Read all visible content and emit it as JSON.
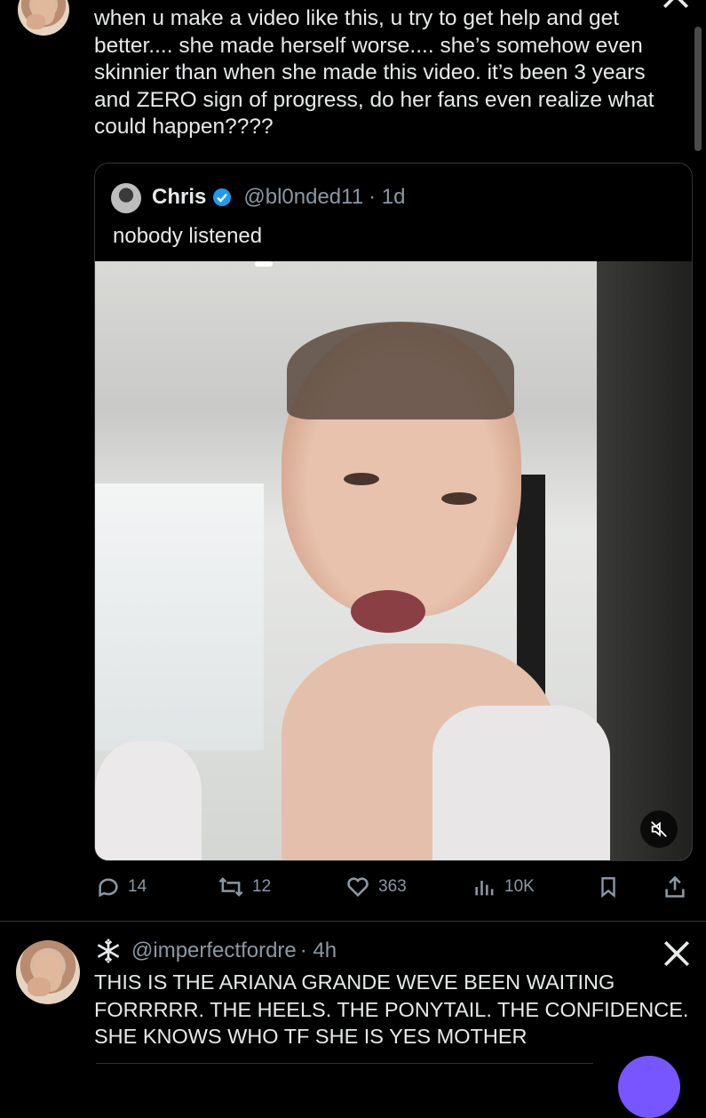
{
  "top_tweet": {
    "text": "when u make a video like this, u try to get help and get better.... she made herself worse.... she’s somehow even skinnier than when she made this video. it’s been 3 years and ZERO sign of progress, do her fans even realize what could happen????",
    "quoted": {
      "display_name": "Chris",
      "handle": "@bl0nded11",
      "time": "· 1d",
      "text": "nobody listened",
      "video_icon": "mute-icon",
      "watermark_icon": "tiktok-icon"
    },
    "actions": {
      "replies": "14",
      "reposts": "12",
      "likes": "363",
      "views": "10K"
    }
  },
  "second_tweet": {
    "display_name_icon": "snowflake-icon",
    "handle": "@imperfectfordre",
    "time": "· 4h",
    "text": "THIS IS THE ARIANA GRANDE WEVE BEEN WAITING FORRRRR. THE HEELS. THE PONYTAIL. THE CONFIDENCE. SHE KNOWS WHO TF SHE IS YES MOTHER",
    "brand_icon": "x-logo-icon"
  },
  "colors": {
    "background": "#000000",
    "text": "#e7e9ea",
    "muted": "#8b98a5",
    "verified": "#1d9bf0",
    "compose_button": "#7856ff"
  }
}
